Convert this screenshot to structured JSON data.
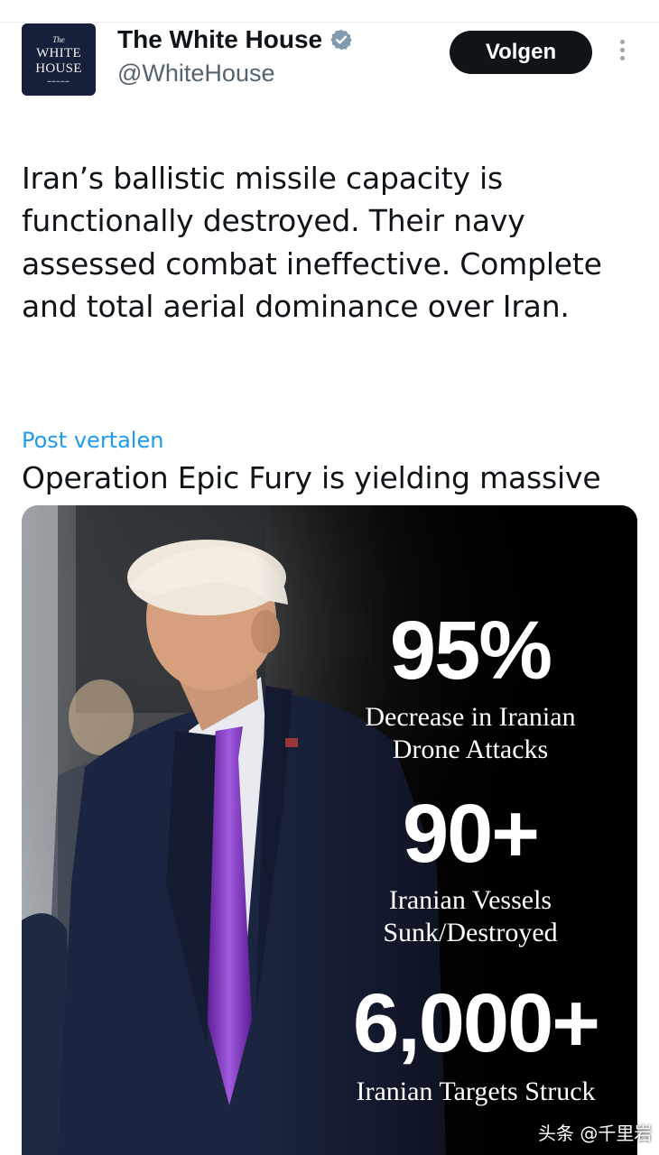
{
  "account": {
    "display_name": "The White House",
    "handle": "@WhiteHouse",
    "verified_icon": "verified-badge-icon",
    "avatar_logo": {
      "line1": "The",
      "line2": "WHITE",
      "line3": "HOUSE"
    }
  },
  "actions": {
    "follow_label": "Volgen",
    "more_icon": "more-vertical-icon"
  },
  "tweet": {
    "paragraph1": "Iran’s ballistic missile capacity is functionally destroyed. Their navy assessed combat ineffective. Complete and total aerial dominance over Iran.",
    "paragraph2": "Operation Epic Fury is yielding massive results.",
    "flag_icon": "us-flag-icon",
    "translate_label": "Post vertalen"
  },
  "media": {
    "stats": [
      {
        "value": "95%",
        "label_line1": "Decrease in Iranian",
        "label_line2": "Drone Attacks"
      },
      {
        "value": "90+",
        "label_line1": "Iranian Vessels",
        "label_line2": "Sunk/Destroyed"
      },
      {
        "value": "6,000+",
        "label_line1": "Iranian Targets Struck",
        "label_line2": ""
      }
    ]
  },
  "watermark": "头条 @千里岩",
  "colors": {
    "follow_bg": "#0f1419",
    "link": "#1d9bf0",
    "tie": "#8b2fc9",
    "suit": "#1b2440",
    "avatar_bg": "#17203a"
  }
}
